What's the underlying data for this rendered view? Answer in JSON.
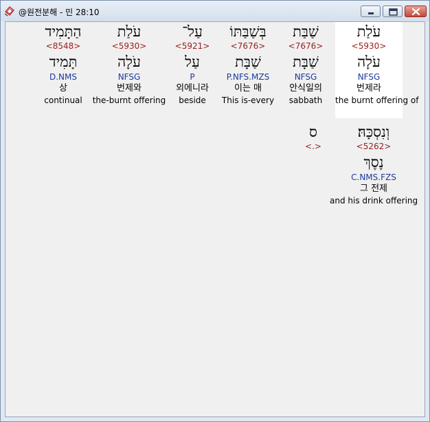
{
  "window": {
    "title": "@원전분해 - 민 28:10",
    "icon": "bible-book-icon",
    "buttons": {
      "minimize": "minimize-icon",
      "maximize": "maximize-icon",
      "close": "close-icon"
    }
  },
  "words": [
    {
      "surface": "עֹלַת",
      "strong": "<5930>",
      "lemma": "עֹלָה",
      "parse": "NFSG",
      "korean": "번제라",
      "english": "the burnt offering of",
      "selected": true
    },
    {
      "surface": "שַׁבַּת",
      "strong": "<7676>",
      "lemma": "שַׁבָּת",
      "parse": "NFSG",
      "korean": "안식일의",
      "english": "sabbath",
      "selected": false
    },
    {
      "surface": "בְּשַׁבַּתּוֹ",
      "strong": "<7676>",
      "lemma": "שַׁבָּת",
      "parse": "P.NFS.MZS",
      "korean": "이는 매",
      "english": "This is-every",
      "selected": false
    },
    {
      "surface": "עַל־",
      "strong": "<5921>",
      "lemma": "עַל",
      "parse": "P",
      "korean": "외에니라",
      "english": "beside",
      "selected": false
    },
    {
      "surface": "עֹלַת",
      "strong": "<5930>",
      "lemma": "עֹלָה",
      "parse": "NFSG",
      "korean": "번제와",
      "english": "the-burnt offering",
      "selected": false
    },
    {
      "surface": "הַתָּמִיד",
      "strong": "<8548>",
      "lemma": "תָּמִיד",
      "parse": "D.NMS",
      "korean": "상",
      "english": "continual",
      "selected": false
    },
    {
      "surface": "וְנִסְכָּהּ׃",
      "strong": "<5262>",
      "lemma": "נֶסֶךְ",
      "parse": "C.NMS.FZS",
      "korean": "그 전제",
      "english": "and his drink offering",
      "selected": false
    },
    {
      "surface": "ס",
      "strong": "<.>",
      "lemma": "",
      "parse": "",
      "korean": "",
      "english": "",
      "selected": false
    }
  ]
}
